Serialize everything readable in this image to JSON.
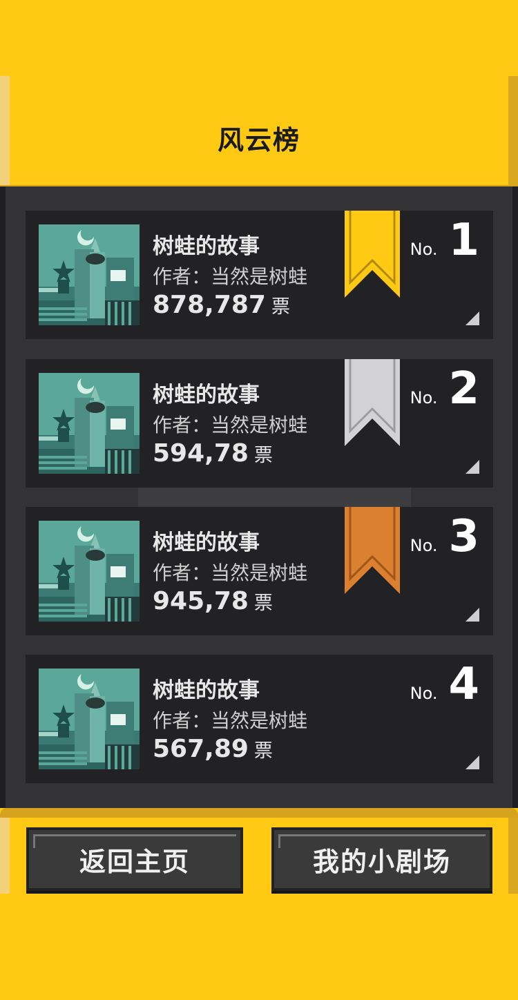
{
  "header": {
    "title": "风云榜"
  },
  "entries": [
    {
      "name": "树蛙的故事",
      "author": "作者：当然是树蛙",
      "votes": "878,787",
      "vote_unit": "票",
      "rank_prefix": "No.",
      "rank": "1",
      "ribbon_color": "#FFC914",
      "ribbon_line": "#B38A10"
    },
    {
      "name": "树蛙的故事",
      "author": "作者：当然是树蛙",
      "votes": "594,78",
      "vote_unit": "票",
      "rank_prefix": "No.",
      "rank": "2",
      "ribbon_color": "#D3D3D5",
      "ribbon_line": "#9C9C9E"
    },
    {
      "name": "树蛙的故事",
      "author": "作者：当然是树蛙",
      "votes": "945,78",
      "vote_unit": "票",
      "rank_prefix": "No.",
      "rank": "3",
      "ribbon_color": "#DA802F",
      "ribbon_line": "#9E561C"
    },
    {
      "name": "树蛙的故事",
      "author": "作者：当然是树蛙",
      "votes": "567,89",
      "vote_unit": "票",
      "rank_prefix": "No.",
      "rank": "4",
      "ribbon_color": null,
      "ribbon_line": null
    }
  ],
  "footer": {
    "home_label": "返回主页",
    "theater_label": "我的小剧场"
  },
  "colors": {
    "accent": "#FFC914",
    "panel": "#333234",
    "card": "#222123"
  }
}
